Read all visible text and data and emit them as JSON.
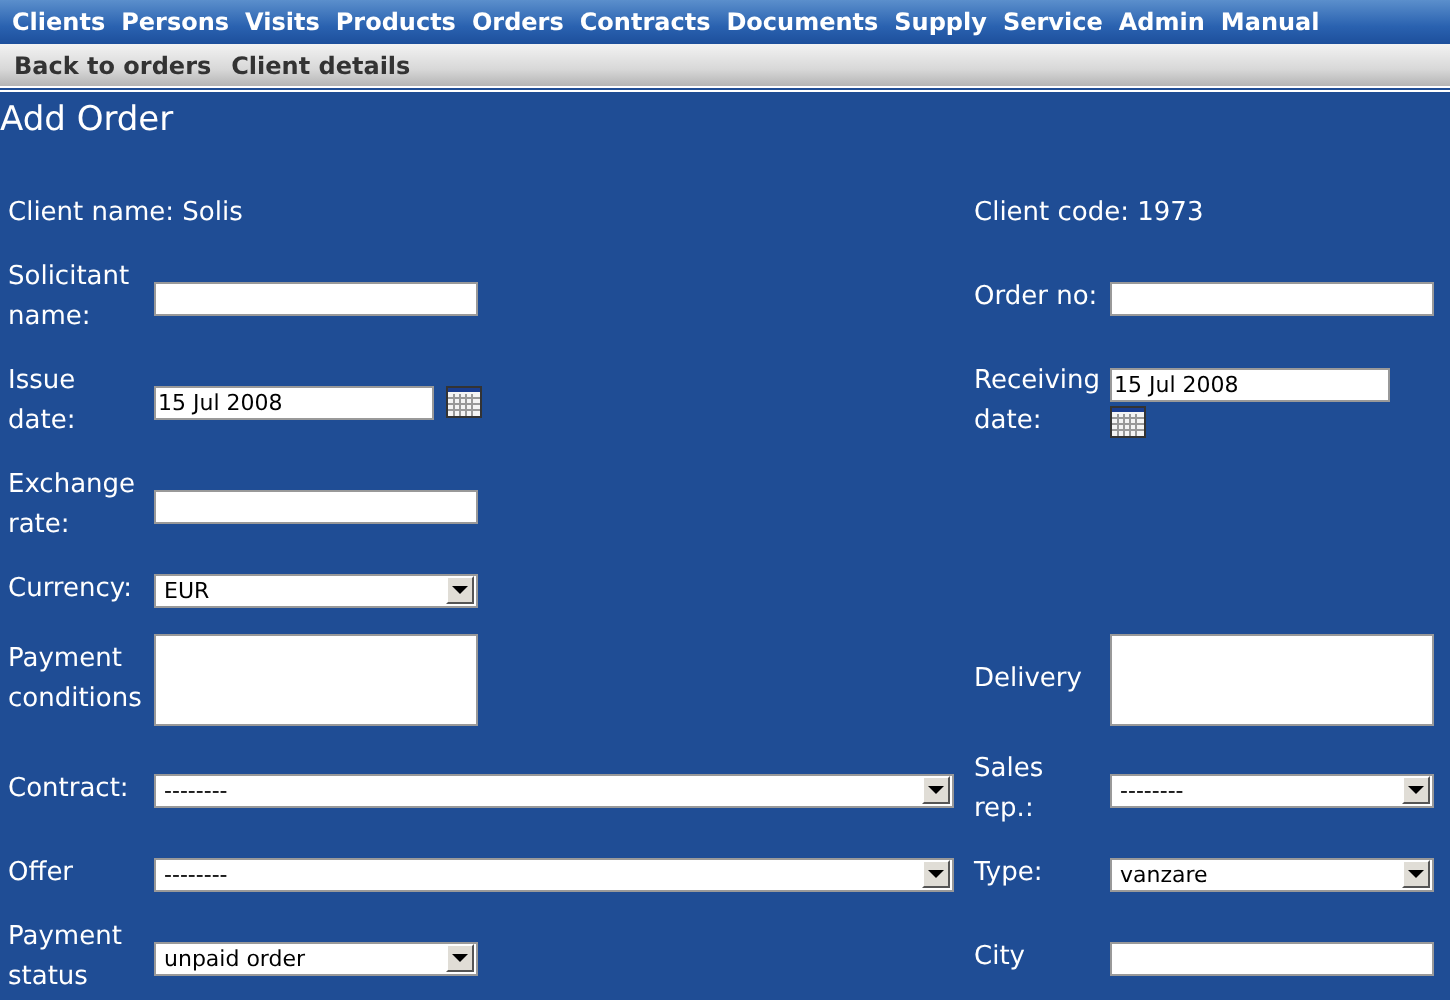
{
  "menu": [
    {
      "label": "Clients"
    },
    {
      "label": "Persons"
    },
    {
      "label": "Visits"
    },
    {
      "label": "Products"
    },
    {
      "label": "Orders"
    },
    {
      "label": "Contracts"
    },
    {
      "label": "Documents"
    },
    {
      "label": "Supply"
    },
    {
      "label": "Service"
    },
    {
      "label": "Admin"
    },
    {
      "label": "Manual"
    }
  ],
  "submenu": [
    {
      "label": "Back to orders"
    },
    {
      "label": "Client details"
    }
  ],
  "title": "Add Order",
  "rows": [
    {
      "left": {
        "kind": "info",
        "text": "Client name: Solis"
      },
      "right": {
        "kind": "info",
        "text": "Client code: 1973"
      }
    },
    {
      "left": {
        "kind": "input",
        "label": "Solicitant name:"
      },
      "right": {
        "kind": "input",
        "label": "Order no:"
      }
    },
    {
      "left": {
        "kind": "date",
        "label": "Issue date:",
        "value": "15 Jul 2008"
      },
      "right": {
        "kind": "date",
        "label": "Receiving date:",
        "value": "15 Jul 2008"
      }
    },
    {
      "left": {
        "kind": "input",
        "label": "Exchange rate:"
      }
    },
    {
      "left": {
        "kind": "select",
        "label": "Currency:",
        "value": "EUR"
      }
    },
    {
      "left": {
        "kind": "textarea",
        "label": "Payment conditions"
      },
      "right": {
        "kind": "textarea",
        "label": "Delivery"
      }
    },
    {
      "left": {
        "kind": "select",
        "label": "Contract:",
        "value": "--------",
        "wide": true
      },
      "right": {
        "kind": "select",
        "label": "Sales rep.:",
        "value": "--------"
      }
    },
    {
      "left": {
        "kind": "select",
        "label": "Offer",
        "value": "--------",
        "wide": true
      },
      "right": {
        "kind": "select",
        "label": "Type:",
        "value": "vanzare"
      }
    },
    {
      "left": {
        "kind": "select",
        "label": "Payment status",
        "value": "unpaid order"
      },
      "right": {
        "kind": "input",
        "label": "City"
      }
    }
  ]
}
